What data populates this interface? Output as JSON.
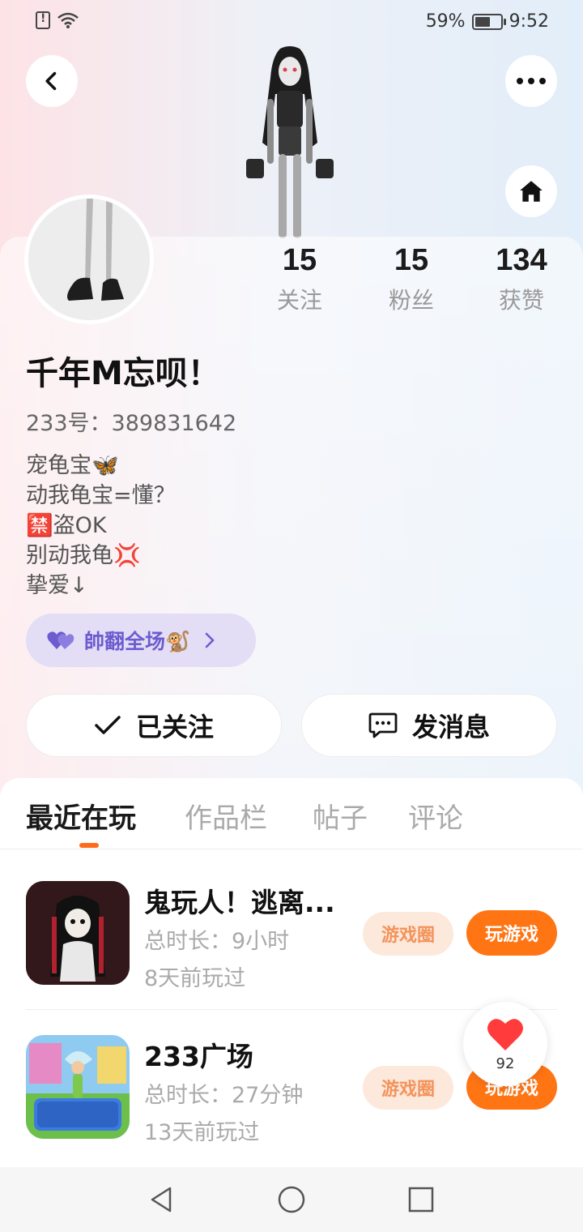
{
  "status_bar": {
    "battery": "59%",
    "time": "9:52"
  },
  "profile": {
    "nickname": "千年M忘呗！",
    "id_label": "233号：",
    "id_value": "389831642",
    "bio": [
      "宠龟宝🦋",
      "动我龟宝=懂？",
      "🈲盗OK",
      "别动我龟💢",
      "挚爱↓"
    ],
    "tag": "帥翻全场🐒",
    "stats": [
      {
        "value": "15",
        "label": "关注"
      },
      {
        "value": "15",
        "label": "粉丝"
      },
      {
        "value": "134",
        "label": "获赞"
      }
    ]
  },
  "actions": {
    "follow_label": "已关注",
    "message_label": "发消息"
  },
  "tabs": [
    "最近在玩",
    "作品栏",
    "帖子",
    "评论"
  ],
  "games": [
    {
      "title": "鬼玩人！逃离...",
      "duration": "总时长：9小时",
      "last_played": "8天前玩过",
      "circle_label": "游戏圈",
      "play_label": "玩游戏"
    },
    {
      "title": "233广场",
      "duration": "总时长：27分钟",
      "last_played": "13天前玩过",
      "circle_label": "游戏圈",
      "play_label": "玩游戏"
    }
  ],
  "like_float": {
    "count": "92"
  },
  "colors": {
    "accent": "#ff7514",
    "tag_bg": "#e3ddf6",
    "tag_text": "#6c5ccf"
  }
}
